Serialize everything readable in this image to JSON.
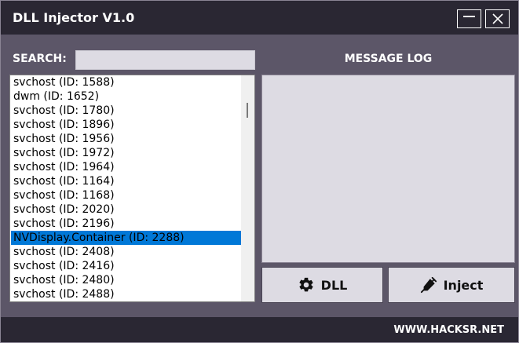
{
  "window": {
    "title": "DLL Injector V1.0"
  },
  "search": {
    "label": "SEARCH:",
    "value": "",
    "placeholder": ""
  },
  "processes": [
    {
      "label": "svchost (ID: 1588)",
      "selected": false
    },
    {
      "label": "dwm (ID: 1652)",
      "selected": false
    },
    {
      "label": "svchost (ID: 1780)",
      "selected": false
    },
    {
      "label": "svchost (ID: 1896)",
      "selected": false
    },
    {
      "label": "svchost (ID: 1956)",
      "selected": false
    },
    {
      "label": "svchost (ID: 1972)",
      "selected": false
    },
    {
      "label": "svchost (ID: 1964)",
      "selected": false
    },
    {
      "label": "svchost (ID: 1164)",
      "selected": false
    },
    {
      "label": "svchost (ID: 1168)",
      "selected": false
    },
    {
      "label": "svchost (ID: 2020)",
      "selected": false
    },
    {
      "label": "svchost (ID: 2196)",
      "selected": false
    },
    {
      "label": "NVDisplay.Container (ID: 2288)",
      "selected": true
    },
    {
      "label": "svchost (ID: 2408)",
      "selected": false
    },
    {
      "label": "svchost (ID: 2416)",
      "selected": false
    },
    {
      "label": "svchost (ID: 2480)",
      "selected": false
    },
    {
      "label": "svchost (ID: 2488)",
      "selected": false
    }
  ],
  "message_log": {
    "label": "MESSAGE LOG",
    "content": ""
  },
  "buttons": {
    "dll_label": "DLL",
    "inject_label": "Inject"
  },
  "footer": {
    "text": "WWW.HACKSR.NET"
  },
  "colors": {
    "background": "#5c5668",
    "titlebar": "#2a2733",
    "selection": "#0078d7",
    "panel": "#dddbe3"
  },
  "icons": {
    "minimize": "minimize-icon",
    "close": "close-icon",
    "dll": "gear-icon",
    "inject": "syringe-icon"
  }
}
